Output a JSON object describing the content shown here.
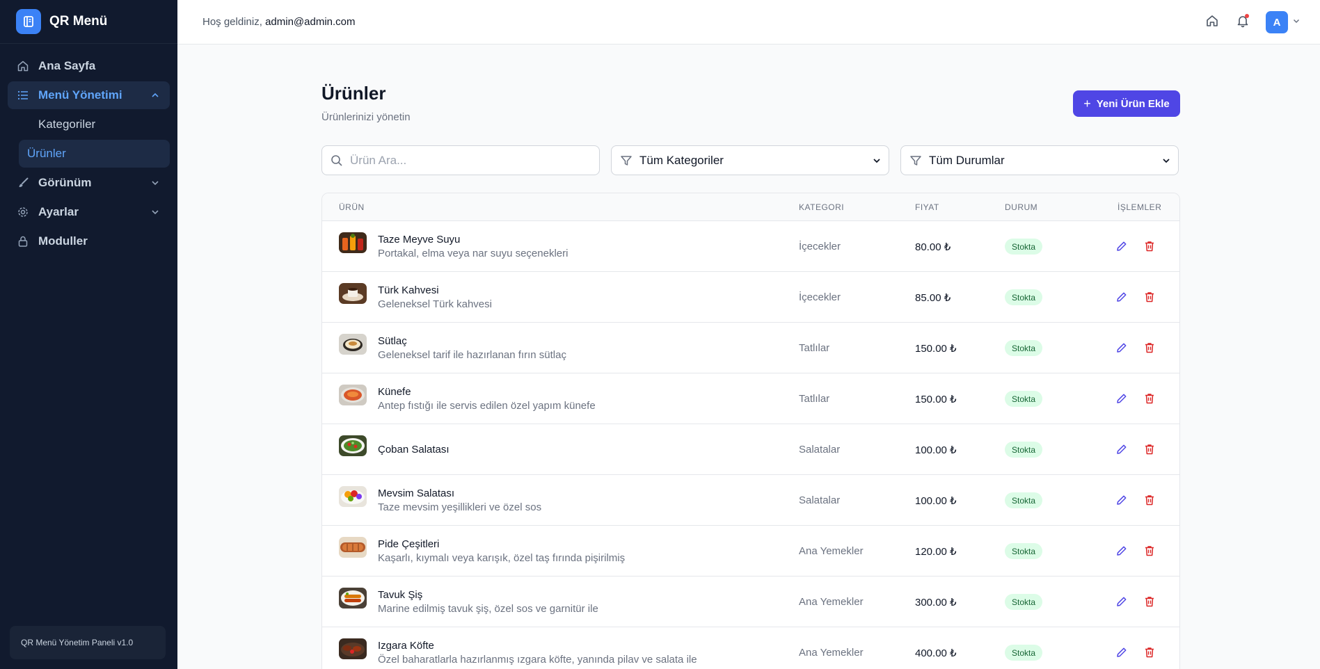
{
  "brand": {
    "name": "QR Menü"
  },
  "sidebar": {
    "items": [
      {
        "label": "Ana Sayfa"
      },
      {
        "label": "Menü Yönetimi"
      },
      {
        "label": "Görünüm"
      },
      {
        "label": "Ayarlar"
      },
      {
        "label": "Moduller"
      }
    ],
    "subitems": [
      {
        "label": "Kategoriler"
      },
      {
        "label": "Ürünler"
      }
    ],
    "footer": "QR Menü Yönetim Paneli v1.0"
  },
  "topbar": {
    "welcome_prefix": "Hoş geldiniz,",
    "user_email": "admin@admin.com",
    "avatar_initial": "A"
  },
  "page": {
    "title": "Ürünler",
    "subtitle": "Ürünlerinizi yönetin",
    "add_button": "Yeni Ürün Ekle"
  },
  "filters": {
    "search_placeholder": "Ürün Ara...",
    "category_selected": "Tüm Kategoriler",
    "status_selected": "Tüm Durumlar"
  },
  "table": {
    "headers": [
      "ÜRÜN",
      "KATEGORI",
      "FIYAT",
      "DURUM",
      "İŞLEMLER"
    ],
    "rows": [
      {
        "name": "Taze Meyve Suyu",
        "desc": "Portakal, elma veya nar suyu seçenekleri",
        "category": "İçecekler",
        "price": "80.00 ₺",
        "status": "Stokta"
      },
      {
        "name": "Türk Kahvesi",
        "desc": "Geleneksel Türk kahvesi",
        "category": "İçecekler",
        "price": "85.00 ₺",
        "status": "Stokta"
      },
      {
        "name": "Sütlaç",
        "desc": "Geleneksel tarif ile hazırlanan fırın sütlaç",
        "category": "Tatlılar",
        "price": "150.00 ₺",
        "status": "Stokta"
      },
      {
        "name": "Künefe",
        "desc": "Antep fıstığı ile servis edilen özel yapım künefe",
        "category": "Tatlılar",
        "price": "150.00 ₺",
        "status": "Stokta"
      },
      {
        "name": "Çoban Salatası",
        "desc": "",
        "category": "Salatalar",
        "price": "100.00 ₺",
        "status": "Stokta"
      },
      {
        "name": "Mevsim Salatası",
        "desc": "Taze mevsim yeşillikleri ve özel sos",
        "category": "Salatalar",
        "price": "100.00 ₺",
        "status": "Stokta"
      },
      {
        "name": "Pide Çeşitleri",
        "desc": "Kaşarlı, kıymalı veya karışık, özel taş fırında pişirilmiş",
        "category": "Ana Yemekler",
        "price": "120.00 ₺",
        "status": "Stokta"
      },
      {
        "name": "Tavuk Şiş",
        "desc": "Marine edilmiş tavuk şiş, özel sos ve garnitür ile",
        "category": "Ana Yemekler",
        "price": "300.00 ₺",
        "status": "Stokta"
      },
      {
        "name": "Izgara Köfte",
        "desc": "Özel baharatlarla hazırlanmış ızgara köfte, yanında pilav ve salata ile",
        "category": "Ana Yemekler",
        "price": "400.00 ₺",
        "status": "Stokta"
      }
    ]
  },
  "colors": {
    "accent": "#4f46e5",
    "sidebar_bg": "#111a2e",
    "active_text": "#60a5fa",
    "badge_bg": "#dcfce7",
    "badge_text": "#166534",
    "delete": "#dc2626"
  }
}
